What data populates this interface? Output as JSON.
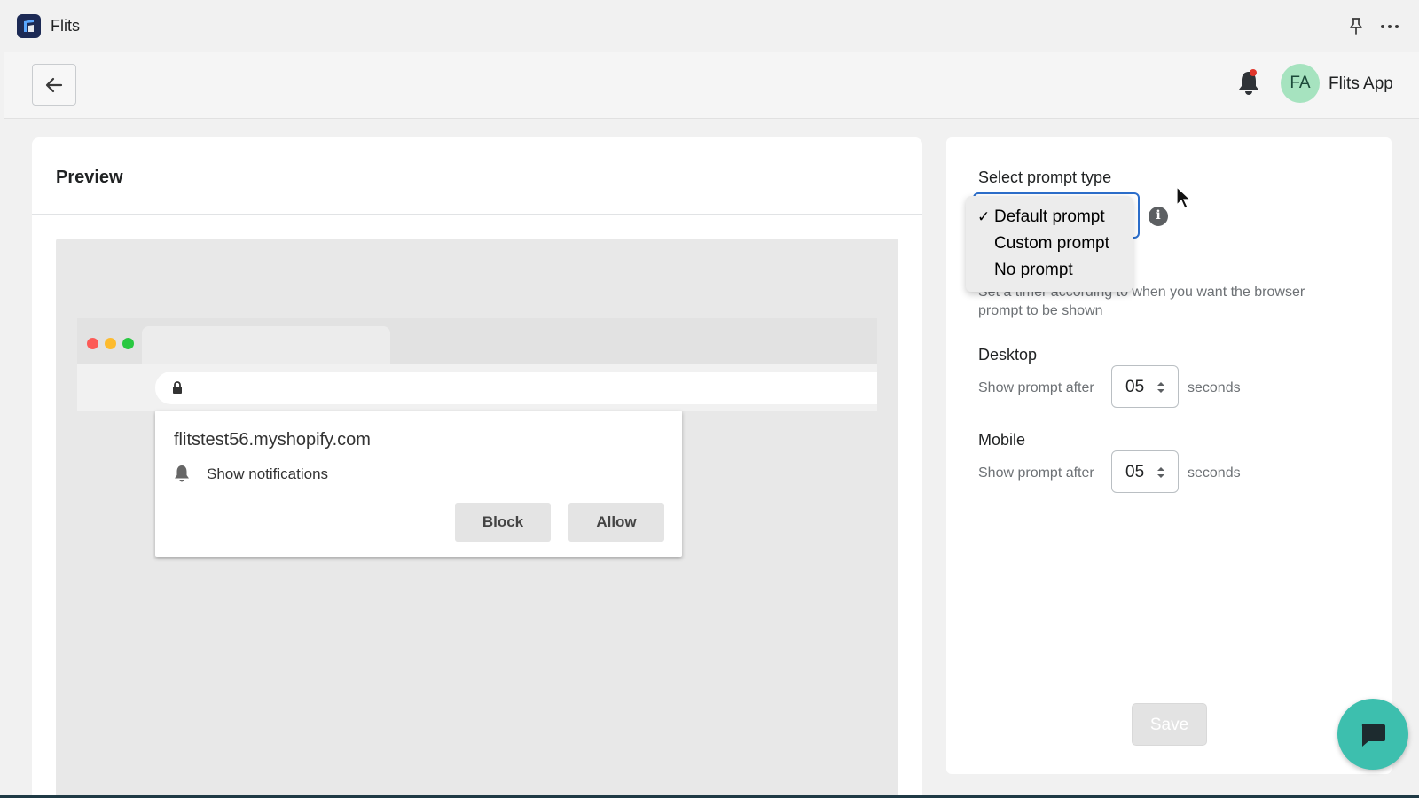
{
  "app": {
    "name": "Flits",
    "logo_icon": "flits-logo-icon",
    "pin_icon": "pin-icon",
    "more_icon": "more-horizontal-icon"
  },
  "header": {
    "back_icon": "arrow-left-icon",
    "bell_icon": "bell-icon",
    "avatar_initials": "FA",
    "user_name": "Flits App",
    "avatar_color": "#a6e3bf"
  },
  "preview": {
    "title": "Preview",
    "domain": "flitstest56.myshopify.com",
    "notification_text": "Show notifications",
    "block_label": "Block",
    "allow_label": "Allow"
  },
  "settings": {
    "select_label": "Select prompt type",
    "options": [
      {
        "label": "Default prompt",
        "selected": true
      },
      {
        "label": "Custom prompt",
        "selected": false
      },
      {
        "label": "No prompt",
        "selected": false
      }
    ],
    "check_mark": "✓",
    "info_icon": "info-icon",
    "timer_help": "Set a timer according to when you want the browser prompt to be shown",
    "desktop": {
      "label": "Desktop",
      "prefix": "Show prompt after",
      "value": "05",
      "suffix": "seconds"
    },
    "mobile": {
      "label": "Mobile",
      "prefix": "Show prompt after",
      "value": "05",
      "suffix": "seconds"
    },
    "save_label": "Save"
  },
  "chat": {
    "icon": "chat-bubble-icon",
    "color": "#3dbfae"
  },
  "colors": {
    "accent": "#2c6ecb",
    "notification_dot": "#e0362c"
  }
}
